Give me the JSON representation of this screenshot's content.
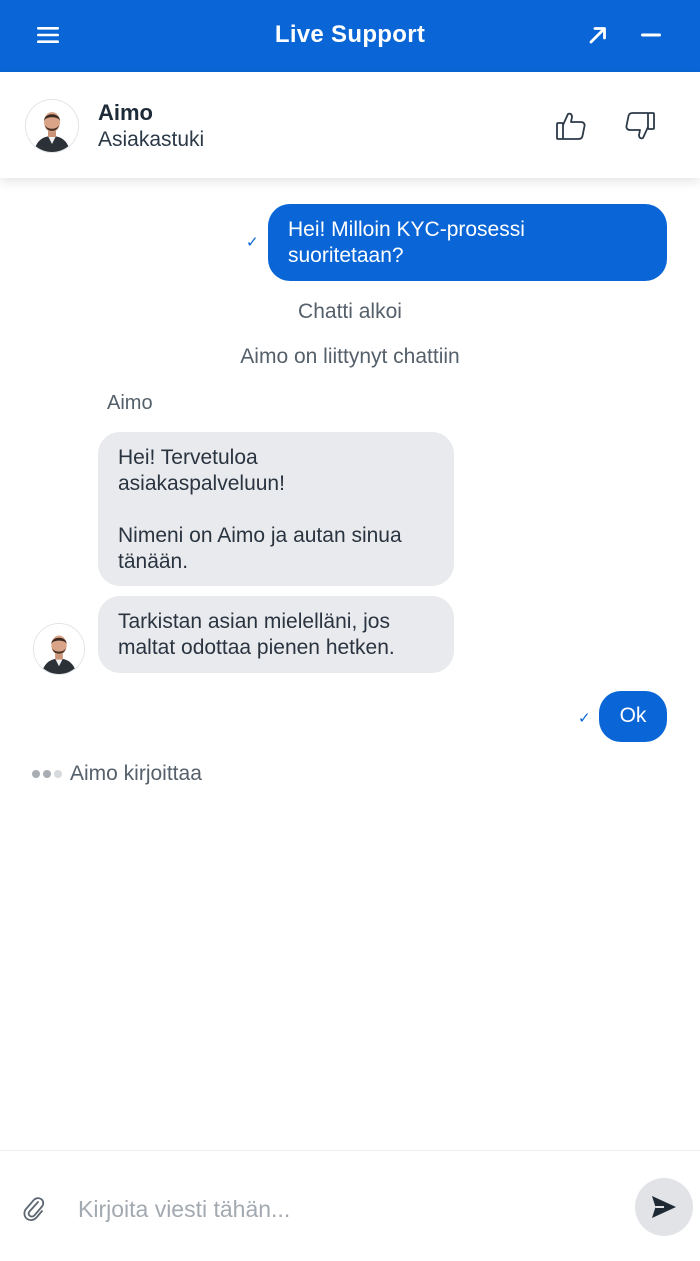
{
  "header": {
    "title": "Live Support",
    "icons": {
      "menu": "hamburger-icon",
      "expand": "arrow-up-right-icon",
      "minimize": "minus-icon"
    }
  },
  "agent": {
    "name": "Aimo",
    "role": "Asiakastuki",
    "icons": {
      "like": "thumbs-up-icon",
      "dislike": "thumbs-down-icon"
    }
  },
  "chat": {
    "user_message_1": {
      "line1": "Hei! Milloin KYC-prosessi",
      "line2": "suoritetaan?",
      "status": "✓"
    },
    "system_1": "Chatti alkoi",
    "system_2": "Aimo on liittynyt chattiin",
    "sender": "Aimo",
    "agent_message_1": {
      "line1": "Hei! Tervetuloa",
      "line2": "asiakaspalveluun!",
      "line3": "Nimeni on Aimo ja autan sinua",
      "line4": "tänään."
    },
    "agent_message_2": {
      "line1": "Tarkistan asian mielelläni, jos",
      "line2": "maltat odottaa pienen hetken."
    },
    "user_message_2": {
      "text": "Ok",
      "status": "✓"
    },
    "typing_indicator": "Aimo kirjoittaa"
  },
  "composer": {
    "placeholder": "Kirjoita viesti tähän...",
    "value": "",
    "icons": {
      "attach": "paperclip-icon",
      "send": "send-icon"
    }
  },
  "colors": {
    "primary": "#0a66d6",
    "incoming_bubble": "#e9eaed",
    "muted_text": "#55606b"
  }
}
